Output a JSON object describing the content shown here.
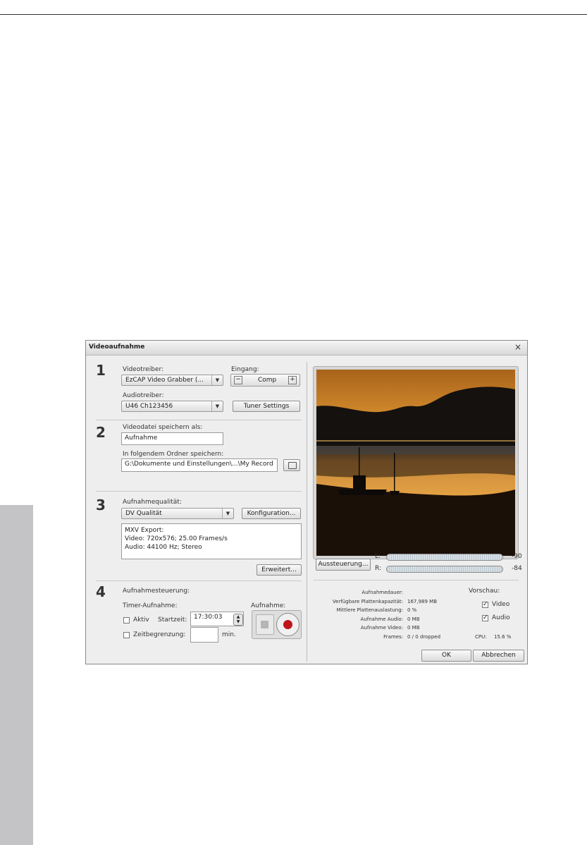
{
  "dialog": {
    "title": "Videoaufnahme",
    "close": "×"
  },
  "section1": {
    "number": "1",
    "video_driver_label": "Videotreiber:",
    "video_driver_value": "EzCAP Video Grabber (...",
    "input_label": "Eingang:",
    "input_value": "Comp",
    "minus": "−",
    "plus": "+",
    "audio_driver_label": "Audiotreiber:",
    "audio_driver_value": "U46 Ch123456",
    "tuner_button": "Tuner Settings"
  },
  "section2": {
    "number": "2",
    "save_as_label": "Videodatei speichern als:",
    "filename_value": "Aufnahme",
    "folder_label": "In folgendem Ordner speichern:",
    "folder_value": "G:\\Dokumente und Einstellungen\\...\\My Record"
  },
  "section3": {
    "number": "3",
    "quality_label": "Aufnahmequalität:",
    "quality_value": "DV Qualität",
    "config_button": "Konfiguration...",
    "info_lines": [
      "MXV Export:",
      "Video: 720x576; 25.00 Frames/s",
      "Audio: 44100 Hz; Stereo"
    ],
    "advanced_button": "Erweitert..."
  },
  "section4": {
    "number": "4",
    "control_label": "Aufnahmesteuerung:",
    "timer_label": "Timer-Aufnahme:",
    "record_label": "Aufnahme:",
    "active_label": "Aktiv",
    "start_label": "Startzeit:",
    "start_value": "17:30:03",
    "limit_label": "Zeitbegrenzung:",
    "limit_value": "",
    "minutes_label": "min."
  },
  "levels": {
    "button": "Aussteuerung...",
    "left_label": "L:",
    "right_label": "R:",
    "left_value": "-90",
    "right_value": "-84"
  },
  "stats": {
    "labels": [
      "Aufnahmedauer:",
      "Verfügbare Plattenkapazität:",
      "Mittlere Plattenauslastung:",
      "Aufnahme Audio:",
      "Aufnahme Video:",
      "Frames:"
    ],
    "values": [
      "",
      "167,989 MB",
      "0 %",
      "0 MB",
      "0 MB",
      "0 / 0 dropped"
    ]
  },
  "preview": {
    "label": "Vorschau:",
    "video_label": "Video",
    "audio_label": "Audio",
    "video_checked": true,
    "audio_checked": true,
    "cpu_label": "CPU:",
    "cpu_value": "15.6 %"
  },
  "footer": {
    "ok": "OK",
    "cancel": "Abbrechen"
  },
  "colors": {
    "dialog_bg": "#eeeeee",
    "record_red": "#c0141c",
    "sidebar_gray": "#c4c4c6"
  }
}
